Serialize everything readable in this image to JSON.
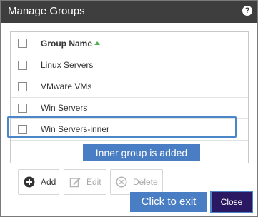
{
  "dialog": {
    "title": "Manage Groups",
    "help_glyph": "?"
  },
  "grid": {
    "column_header": "Group Name",
    "sort_direction": "ascending",
    "rows": [
      {
        "label": "Linux Servers",
        "checked": false
      },
      {
        "label": "VMware VMs",
        "checked": false
      },
      {
        "label": "Win Servers",
        "checked": false
      },
      {
        "label": "Win Servers-inner",
        "checked": false
      }
    ]
  },
  "annotations": {
    "inner_group_callout": "Inner group is added",
    "exit_callout": "Click to exit"
  },
  "buttons": {
    "add": "Add",
    "edit": "Edit",
    "delete": "Delete",
    "close": "Close"
  },
  "colors": {
    "titlebar": "#3e3e3e",
    "callout": "#4a7ec4",
    "close_button": "#2b1862",
    "sort_arrow": "#4caf50"
  }
}
